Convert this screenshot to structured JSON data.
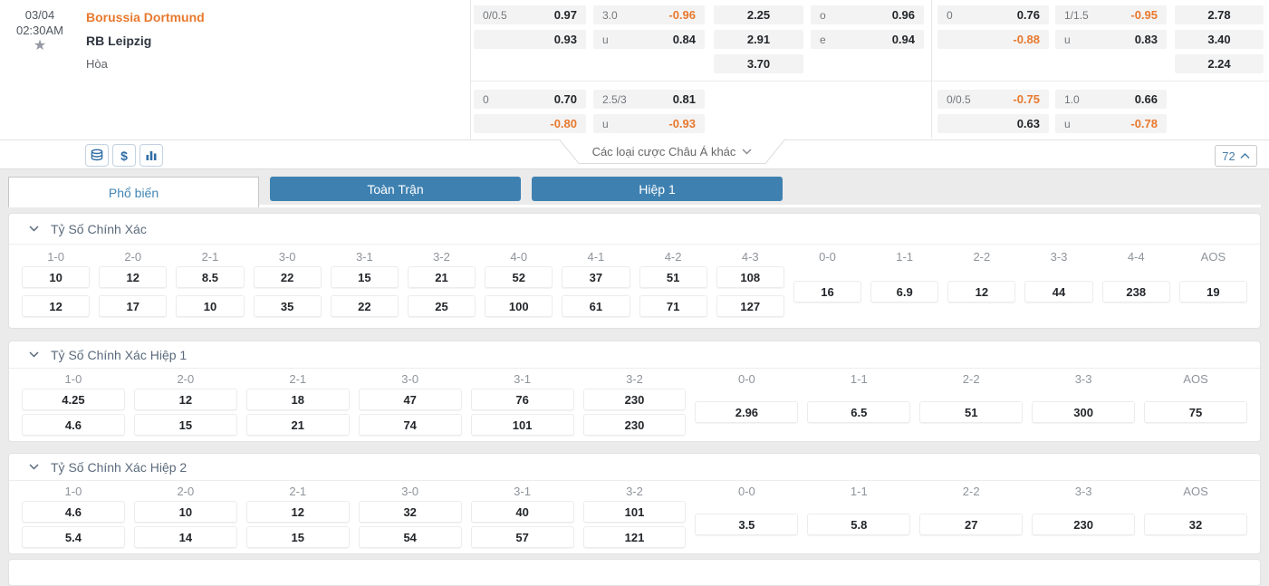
{
  "colors": {
    "accent_orange": "#e8792e",
    "primary_blue": "#3e81b1",
    "link_blue": "#4a7fa8",
    "negative_odds": "#e8792e"
  },
  "icons": {
    "favorite-star": "★",
    "stack-icon": "stacked-discs-outline",
    "dollar-icon": "$",
    "bar-chart-icon": "vertical-bars",
    "chevron-down-icon": "∨",
    "chevron-up-icon": "∧"
  },
  "match": {
    "date": "03/04",
    "time": "02:30AM",
    "home_team": "Borussia Dortmund",
    "away_team": "RB Leipzig",
    "draw_label": "Hòa"
  },
  "odds": {
    "row1_left": {
      "hdp_line": "0/0.5",
      "hdp_home": "0.97",
      "hdp_away": "0.93",
      "ou_line": "3.0",
      "ou_over": "-0.96",
      "ou_under_label": "u",
      "ou_under": "0.84",
      "x12_home": "2.25",
      "x12_away": "2.91",
      "x12_draw": "3.70",
      "oe_odd_label": "o",
      "oe_odd": "0.96",
      "oe_even_label": "e",
      "oe_even": "0.94"
    },
    "row1_right": {
      "hdp_line": "0",
      "hdp_home": "0.76",
      "hdp_away": "-0.88",
      "ou_line": "1/1.5",
      "ou_over": "-0.95",
      "ou_under_label": "u",
      "ou_under": "0.83",
      "x12_home": "2.78",
      "x12_away": "3.40",
      "x12_draw": "2.24"
    },
    "row2_left": {
      "hdp_line": "0",
      "hdp_home": "0.70",
      "hdp_away": "-0.80",
      "ou_line": "2.5/3",
      "ou_over": "0.81",
      "ou_under_label": "u",
      "ou_under": "-0.93"
    },
    "row2_right": {
      "hdp_line": "0/0.5",
      "hdp_home": "-0.75",
      "hdp_away": "0.63",
      "ou_line": "1.0",
      "ou_over": "0.66",
      "ou_under_label": "u",
      "ou_under": "-0.78"
    }
  },
  "toolbar": {
    "more_bets_label": "Các loại cược Châu Á khác",
    "market_count": "72"
  },
  "tabs": [
    {
      "label": "Phổ biến",
      "active": true
    },
    {
      "label": "Toàn Trận",
      "active": false
    },
    {
      "label": "Hiệp 1",
      "active": false
    }
  ],
  "score_sections": [
    {
      "title": "Tỷ Số Chính Xác",
      "columns": [
        {
          "score": "1-0",
          "values": [
            "10",
            "12"
          ]
        },
        {
          "score": "2-0",
          "values": [
            "12",
            "17"
          ]
        },
        {
          "score": "2-1",
          "values": [
            "8.5",
            "10"
          ]
        },
        {
          "score": "3-0",
          "values": [
            "22",
            "35"
          ]
        },
        {
          "score": "3-1",
          "values": [
            "15",
            "22"
          ]
        },
        {
          "score": "3-2",
          "values": [
            "21",
            "25"
          ]
        },
        {
          "score": "4-0",
          "values": [
            "52",
            "100"
          ]
        },
        {
          "score": "4-1",
          "values": [
            "37",
            "61"
          ]
        },
        {
          "score": "4-2",
          "values": [
            "51",
            "71"
          ]
        },
        {
          "score": "4-3",
          "values": [
            "108",
            "127"
          ]
        },
        {
          "score": "0-0",
          "values": [
            "16"
          ]
        },
        {
          "score": "1-1",
          "values": [
            "6.9"
          ]
        },
        {
          "score": "2-2",
          "values": [
            "12"
          ]
        },
        {
          "score": "3-3",
          "values": [
            "44"
          ]
        },
        {
          "score": "4-4",
          "values": [
            "238"
          ]
        },
        {
          "score": "AOS",
          "values": [
            "19"
          ]
        }
      ]
    },
    {
      "title": "Tỷ Số Chính Xác Hiệp 1",
      "columns": [
        {
          "score": "1-0",
          "values": [
            "4.25",
            "4.6"
          ]
        },
        {
          "score": "2-0",
          "values": [
            "12",
            "15"
          ]
        },
        {
          "score": "2-1",
          "values": [
            "18",
            "21"
          ]
        },
        {
          "score": "3-0",
          "values": [
            "47",
            "74"
          ]
        },
        {
          "score": "3-1",
          "values": [
            "76",
            "101"
          ]
        },
        {
          "score": "3-2",
          "values": [
            "230",
            "230"
          ]
        },
        {
          "score": "0-0",
          "values": [
            "2.96"
          ]
        },
        {
          "score": "1-1",
          "values": [
            "6.5"
          ]
        },
        {
          "score": "2-2",
          "values": [
            "51"
          ]
        },
        {
          "score": "3-3",
          "values": [
            "300"
          ]
        },
        {
          "score": "AOS",
          "values": [
            "75"
          ]
        }
      ]
    },
    {
      "title": "Tỷ Số Chính Xác Hiệp 2",
      "columns": [
        {
          "score": "1-0",
          "values": [
            "4.6",
            "5.4"
          ]
        },
        {
          "score": "2-0",
          "values": [
            "10",
            "14"
          ]
        },
        {
          "score": "2-1",
          "values": [
            "12",
            "15"
          ]
        },
        {
          "score": "3-0",
          "values": [
            "32",
            "54"
          ]
        },
        {
          "score": "3-1",
          "values": [
            "40",
            "57"
          ]
        },
        {
          "score": "3-2",
          "values": [
            "101",
            "121"
          ]
        },
        {
          "score": "0-0",
          "values": [
            "3.5"
          ]
        },
        {
          "score": "1-1",
          "values": [
            "5.8"
          ]
        },
        {
          "score": "2-2",
          "values": [
            "27"
          ]
        },
        {
          "score": "3-3",
          "values": [
            "230"
          ]
        },
        {
          "score": "AOS",
          "values": [
            "32"
          ]
        }
      ]
    }
  ]
}
